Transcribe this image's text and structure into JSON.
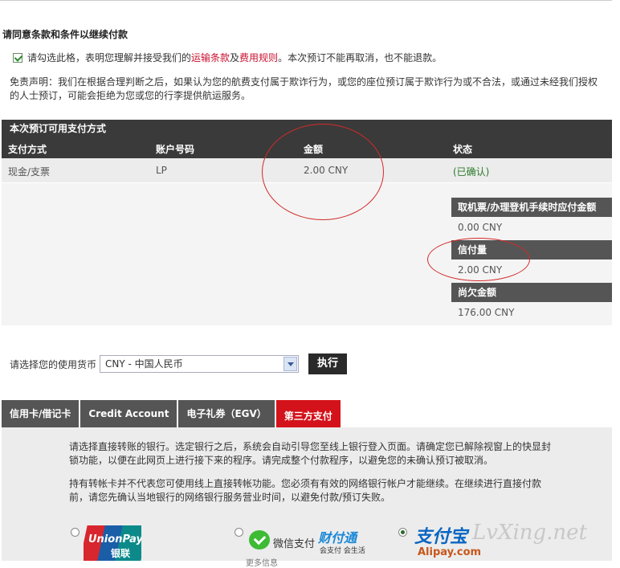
{
  "terms": {
    "title": "请同意条款和条件以继续付款",
    "checkbox_text_1": "请勾选此格，表明您理解并接受我们的",
    "link_transport": "运输条款",
    "and_text": "及",
    "link_fee": "费用规则",
    "checkbox_text_2": "。本次预订不能再取消，也不能退款。",
    "checked": true,
    "disclaimer": "免责声明：我们在根据合理判断之后，如果认为您的航费支付属于欺诈行为，或您的座位预订属于欺诈行为或不合法，或通过未经我们授权的人士预订，可能会拒绝为您或您的行李提供航运服务。"
  },
  "payment_methods": {
    "title": "本次预订可用支付方式",
    "columns": [
      "支付方式",
      "账户号码",
      "金额",
      "状态"
    ],
    "rows": [
      {
        "method": "现金/支票",
        "account": "LP",
        "amount": "2.00 CNY",
        "status": "(已确认)"
      }
    ]
  },
  "summary": {
    "due_label": "取机票/办理登机手续时应付金额",
    "due_value": "0.00 CNY",
    "credit_label": "信付量",
    "credit_value": "2.00 CNY",
    "owed_label": "尚欠金额",
    "owed_value": "176.00 CNY"
  },
  "currency": {
    "label": "请选择您的使用货币",
    "selected": "CNY - 中国人民币",
    "execute_label": "执行"
  },
  "tabs": [
    {
      "label": "信用卡/借记卡",
      "active": false
    },
    {
      "label": "Credit Account",
      "active": false
    },
    {
      "label": "电子礼券（EGV）",
      "active": false
    },
    {
      "label": "第三方支付",
      "active": true
    }
  ],
  "panel": {
    "para1": "请选择直接转账的银行。选定银行之后，系统会自动引导您至线上银行登入页面。请确定您已解除视窗上的快显封锁功能，以便在此网页上进行接下来的程序。请完成整个付款程序，以避免您的未确认预订被取消。",
    "para2": "持有转帐卡并不代表您可使用线上直接转帐功能。您必须有有效的网络银行帐户才能继续。在继续进行直接付款前，请您先确认当地银行的网络银行服务营业时间，以避免付款/预订失败。"
  },
  "providers": {
    "unionpay_text": "UnionPay",
    "unionpay_cn": "银联",
    "wechat_label": "微信支付",
    "tenpay_label": "财付通",
    "tenpay_sub": "会支付 会生活",
    "wechat_more": "更多信息",
    "alipay_label": "支付宝",
    "alipay_sub": "Alipay.com",
    "selected": "alipay"
  },
  "watermark": "LvXing.net"
}
